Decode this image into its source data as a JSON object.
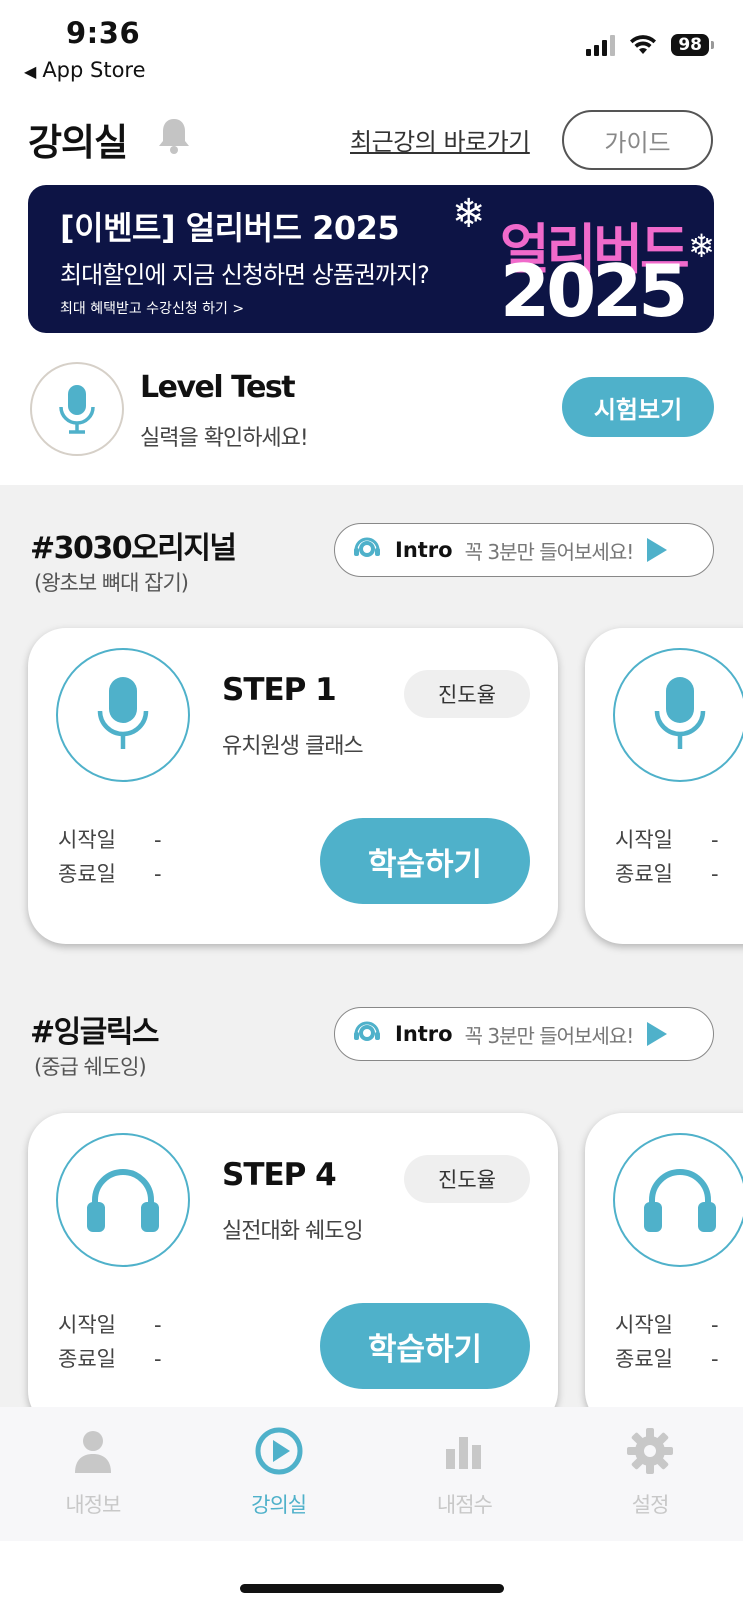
{
  "status_bar": {
    "time": "9:36",
    "back_label": "App Store",
    "battery": "98"
  },
  "header": {
    "title": "강의실",
    "recent_link": "최근강의 바로가기",
    "guide_button": "가이드"
  },
  "banner": {
    "title": "[이벤트] 얼리버드 2025",
    "subtitle": "최대할인에 지금 신청하면 상품권까지?",
    "small": "최대 혜택받고 수강신청 하기 >",
    "art_top": "얼리버드",
    "art_bottom": "2025"
  },
  "level_test": {
    "title": "Level Test",
    "subtitle": "실력을 확인하세요!",
    "button": "시험보기"
  },
  "courses": [
    {
      "title": "#3030오리지널",
      "subtitle": "(왕초보 뼈대 잡기)",
      "intro_label": "Intro",
      "intro_text": "꼭 3분만 들어보세요!",
      "card": {
        "step": "STEP 1",
        "progress_label": "진도율",
        "class_name": "유치원생 클래스",
        "start_label": "시작일",
        "start_value": "-",
        "end_label": "종료일",
        "end_value": "-",
        "button": "학습하기",
        "icon": "microphone-icon"
      },
      "peek": {
        "start_label": "시작일",
        "start_value": "-",
        "end_label": "종료일",
        "end_value": "-"
      }
    },
    {
      "title": "#잉글릭스",
      "subtitle": "(중급 쉐도잉)",
      "intro_label": "Intro",
      "intro_text": "꼭 3분만 들어보세요!",
      "card": {
        "step": "STEP 4",
        "progress_label": "진도율",
        "class_name": "실전대화 쉐도잉",
        "start_label": "시작일",
        "start_value": "-",
        "end_label": "종료일",
        "end_value": "-",
        "button": "학습하기",
        "icon": "headphones-icon"
      },
      "peek": {
        "start_label": "시작일",
        "start_value": "-",
        "end_label": "종료일",
        "end_value": "-"
      }
    }
  ],
  "tabbar": [
    {
      "label": "내정보",
      "icon": "person-icon",
      "active": false
    },
    {
      "label": "강의실",
      "icon": "play-circle-icon",
      "active": true
    },
    {
      "label": "내점수",
      "icon": "bar-chart-icon",
      "active": false
    },
    {
      "label": "설정",
      "icon": "gear-icon",
      "active": false
    }
  ],
  "colors": {
    "accent": "#4fb1ca",
    "banner_bg": "#0d1445",
    "banner_pink": "#f06acb",
    "gray_bg": "#f1f1f1"
  }
}
